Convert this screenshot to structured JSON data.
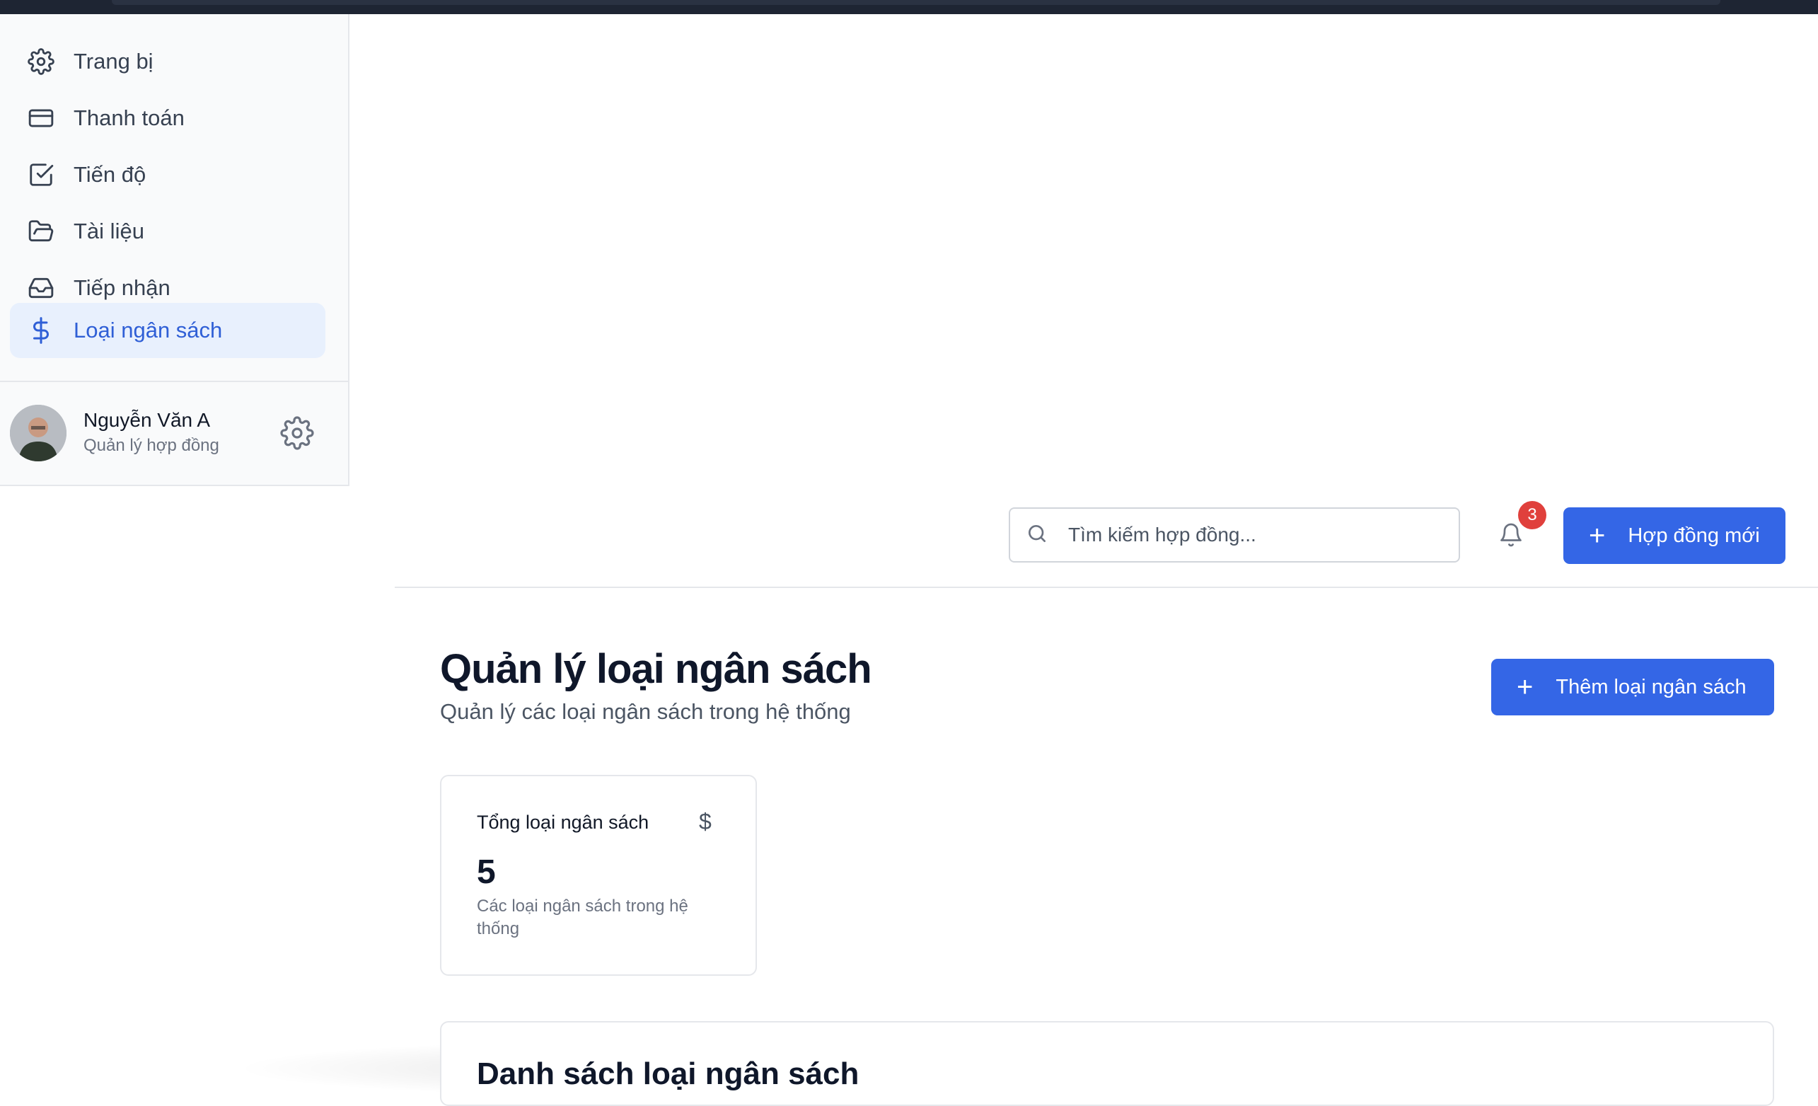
{
  "sidebar": {
    "items": [
      {
        "label": "Trang bị",
        "icon": "gear-icon",
        "active": false
      },
      {
        "label": "Thanh toán",
        "icon": "credit-card-icon",
        "active": false
      },
      {
        "label": "Tiến độ",
        "icon": "check-square-icon",
        "active": false
      },
      {
        "label": "Tài liệu",
        "icon": "folder-open-icon",
        "active": false
      },
      {
        "label": "Tiếp nhận",
        "icon": "inbox-icon",
        "active": false
      },
      {
        "label": "Loại ngân sách",
        "icon": "dollar-icon",
        "active": true
      }
    ],
    "user": {
      "name": "Nguyễn Văn A",
      "role": "Quản lý hợp đồng"
    }
  },
  "header": {
    "search_placeholder": "Tìm kiếm hợp đồng...",
    "notification_count": "3",
    "new_contract_label": "Hợp đồng mới"
  },
  "main": {
    "title": "Quản lý loại ngân sách",
    "subtitle": "Quản lý các loại ngân sách trong hệ thống",
    "add_button_label": "Thêm loại ngân sách",
    "stat": {
      "label": "Tổng loại ngân sách",
      "symbol": "$",
      "value": "5",
      "description": "Các loại ngân sách trong hệ thống"
    },
    "list_title": "Danh sách loại ngân sách"
  },
  "colors": {
    "accent": "#3466e6",
    "active_bg": "#e8f0fd",
    "badge": "#e0403c"
  }
}
